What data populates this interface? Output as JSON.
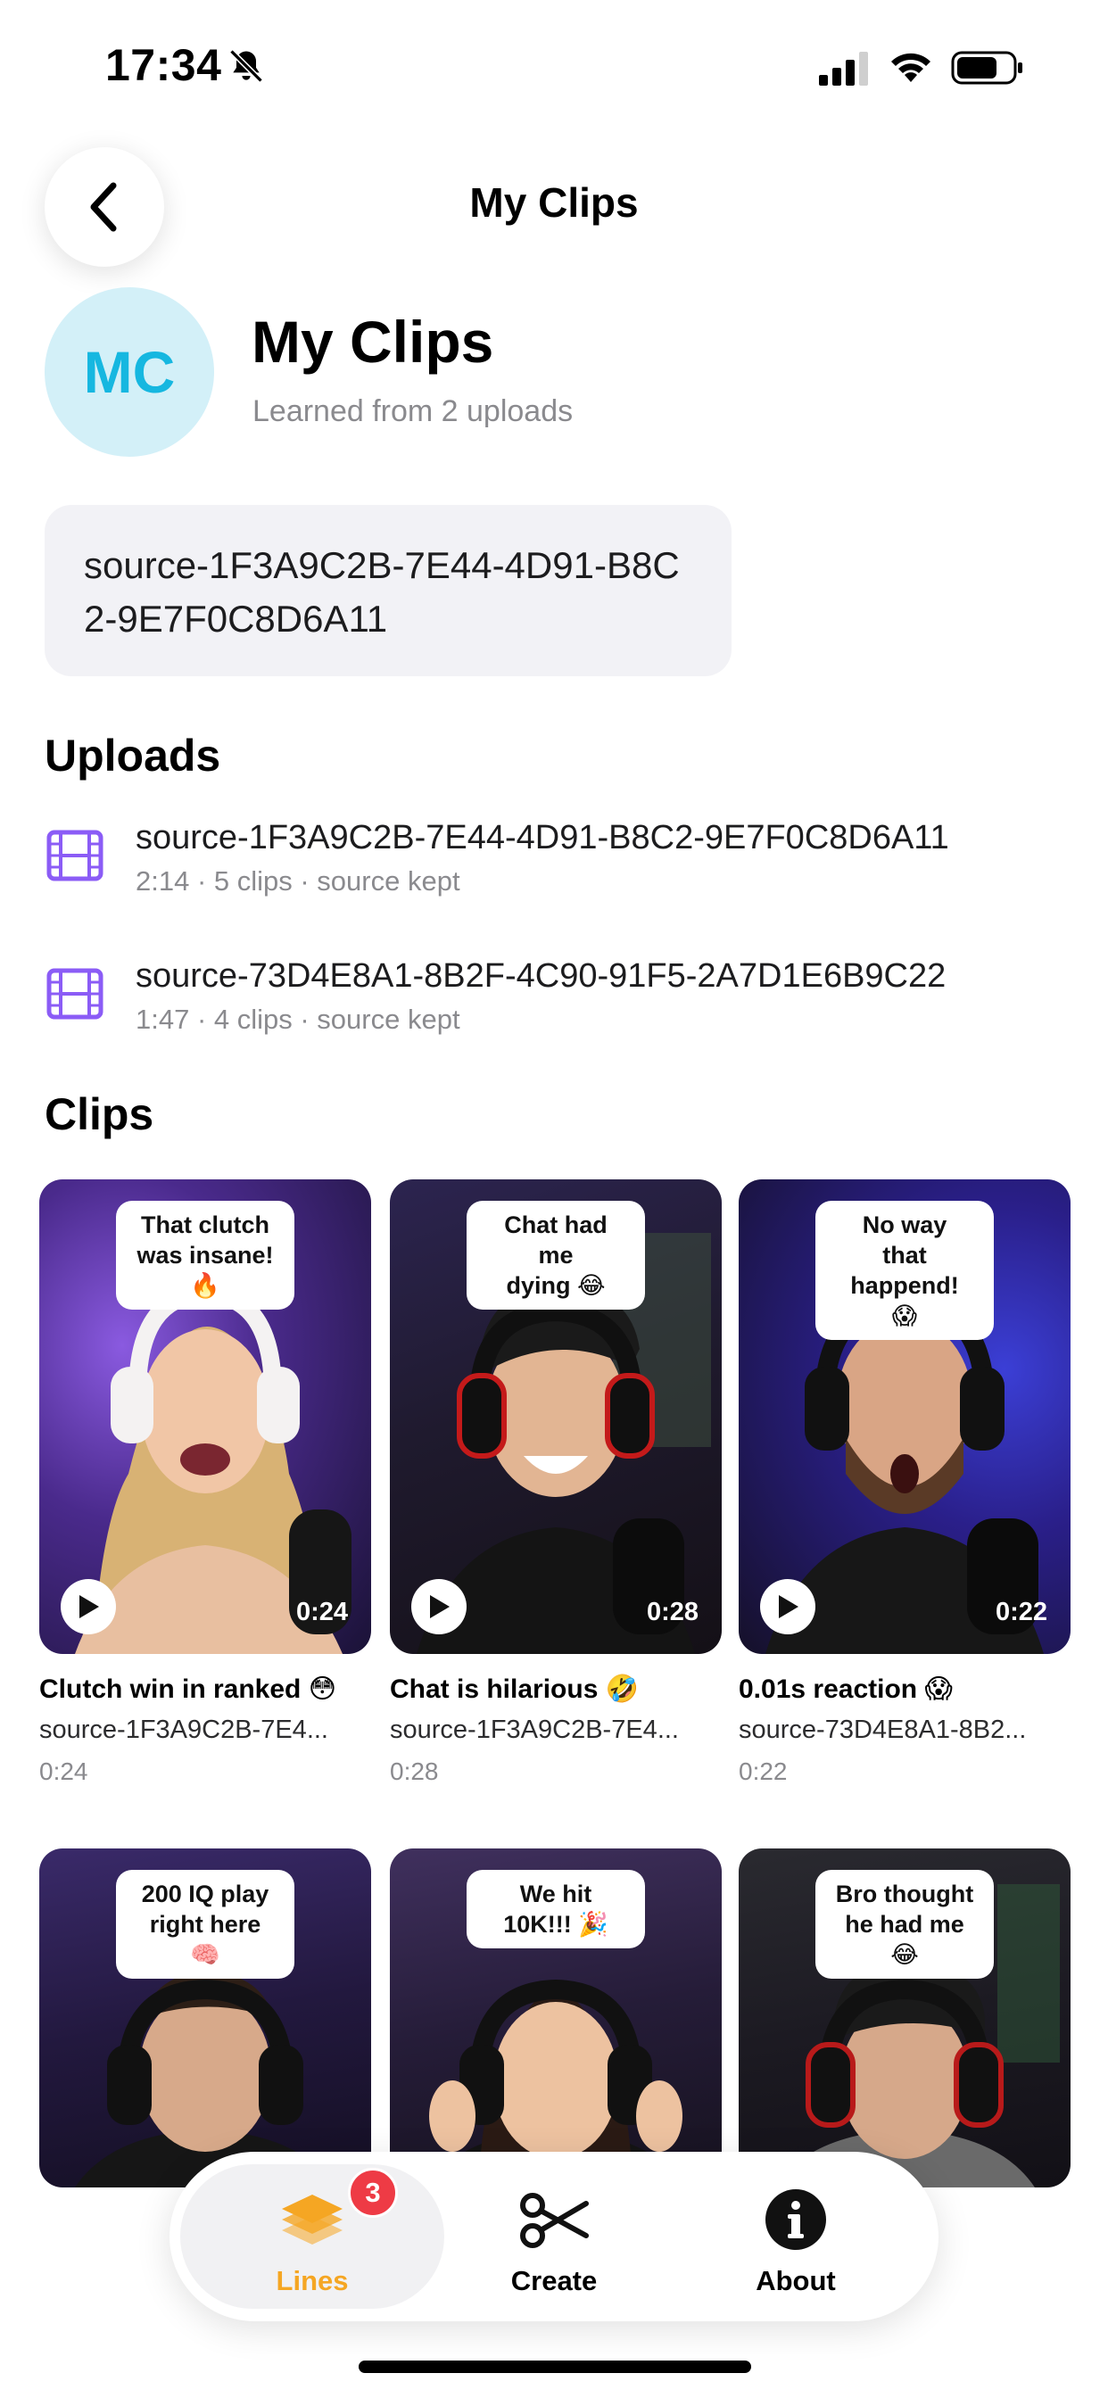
{
  "status_bar": {
    "time": "17:34"
  },
  "nav": {
    "title": "My Clips"
  },
  "profile": {
    "initials": "MC",
    "name": "My Clips",
    "subtitle": "Learned from 2 uploads"
  },
  "source_chip": "source-1F3A9C2B-7E44-4D91-B8C2-9E7F0C8D6A11",
  "uploads_section": {
    "title": "Uploads",
    "items": [
      {
        "name": "source-1F3A9C2B-7E44-4D91-B8C2-9E7F0C8D6A11",
        "meta": "2:14 · 5 clips · source kept",
        "icon": "film-icon"
      },
      {
        "name": "source-73D4E8A1-8B2F-4C90-91F5-2A7D1E6B9C22",
        "meta": "1:47 · 4 clips · source kept",
        "icon": "film-icon"
      }
    ]
  },
  "clips_section": {
    "title": "Clips",
    "items": [
      {
        "caption": "That clutch\nwas insane! 🔥",
        "duration": "0:24",
        "title": "Clutch win in ranked 😳",
        "source": "source-1F3A9C2B-7E4...",
        "meta": "0:24"
      },
      {
        "caption": "Chat had me\ndying 😂",
        "duration": "0:28",
        "title": "Chat is hilarious 🤣",
        "source": "source-1F3A9C2B-7E4...",
        "meta": "0:28"
      },
      {
        "caption": "No way\nthat happend!\n😱",
        "duration": "0:22",
        "title": "0.01s reaction 😱",
        "source": "source-73D4E8A1-8B2...",
        "meta": "0:22"
      },
      {
        "caption": "200 IQ play\nright here 🧠"
      },
      {
        "caption": "We hit\n10K!!! 🎉"
      },
      {
        "caption": "Bro thought\nhe had me 😂"
      }
    ]
  },
  "tab_bar": {
    "tabs": [
      {
        "label": "Lines",
        "icon": "layers-icon",
        "badge": "3",
        "active": true
      },
      {
        "label": "Create",
        "icon": "scissors-icon"
      },
      {
        "label": "About",
        "icon": "info-icon"
      }
    ]
  },
  "colors": {
    "accent_orange": "#F5A623",
    "avatar_bg": "#D3F0F8",
    "avatar_text": "#16B7E0",
    "film_purple": "#8B5CF6",
    "badge_red": "#EE3B45"
  }
}
